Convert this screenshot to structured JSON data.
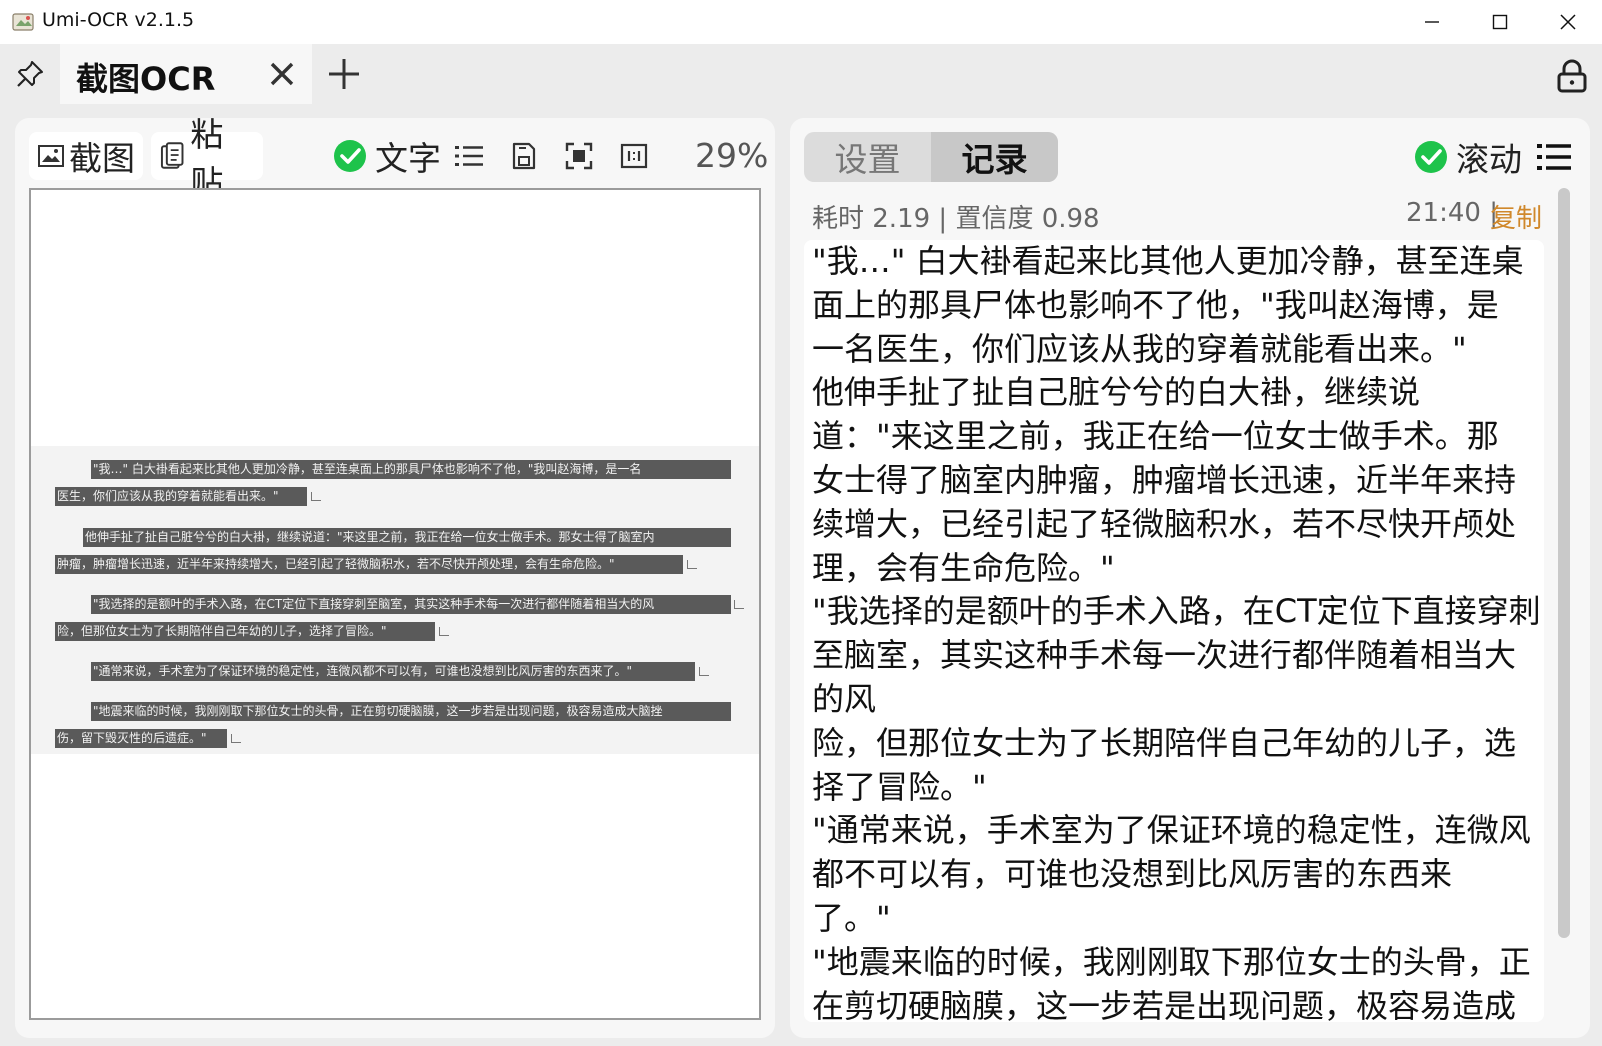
{
  "window": {
    "title": "Umi-OCR v2.1.5",
    "controls": [
      "minimize",
      "maximize",
      "close"
    ]
  },
  "tabs": {
    "active_label": "截图OCR",
    "icons": {
      "pin": "pin-icon",
      "close": "close-icon",
      "add": "plus-icon",
      "lock": "lock-icon"
    }
  },
  "left_toolbar": {
    "screenshot_label": "截图",
    "paste_label": "粘贴",
    "text_toggle_label": "文字",
    "text_toggle_checked": true,
    "zoom": "29%"
  },
  "image_preview": {
    "lines": [
      "\"我…\" 白大褂看起来比其他人更加冷静，甚至连桌面上的那具尸体也影响不了他，\"我叫赵海博，是一名",
      "医生，你们应该从我的穿着就能看出来。\"",
      "他伸手扯了扯自己脏兮兮的白大褂，继续说道：\"来这里之前，我正在给一位女士做手术。那女士得了脑室内",
      "肿瘤，肿瘤增长迅速，近半年来持续增大，已经引起了轻微脑积水，若不尽快开颅处理，会有生命危险。\"",
      "\"我选择的是额叶的手术入路，在CT定位下直接穿刺至脑室，其实这种手术每一次进行都伴随着相当大的风",
      "险，但那位女士为了长期陪伴自己年幼的儿子，选择了冒险。\"",
      "\"通常来说，手术室为了保证环境的稳定性，连微风都不可以有，可谁也没想到比风厉害的东西来了。\"",
      "\"地震来临的时候，我刚刚取下那位女士的头骨，正在剪切硬脑膜，这一步若是出现问题，极容易造成大脑挫",
      "伤，留下毁灭性的后遗症。\""
    ]
  },
  "right_panel": {
    "tab_settings": "设置",
    "tab_records": "记录",
    "scroll_label": "滚动",
    "scroll_checked": true,
    "record": {
      "meta": "耗时 2.19 | 置信度 0.98",
      "time": "21:40 |",
      "copy_label": "复制",
      "lines": [
        "\"我…\" 白大褂看起来比其他人更加冷静，甚至连桌",
        "面上的那具尸体也影响不了他，\"我叫赵海博，是",
        "一名医生，你们应该从我的穿着就能看出来。\"",
        "他伸手扯了扯自己脏兮兮的白大褂，继续说",
        "道：\"来这里之前，我正在给一位女士做手术。那",
        "女士得了脑室内肿瘤，肿瘤增长迅速，近半年来持",
        "续增大，已经引起了轻微脑积水，若不尽快开颅处",
        "理，会有生命危险。\"",
        "\"我选择的是额叶的手术入路，在CT定位下直接穿刺",
        "至脑室，其实这种手术每一次进行都伴随着相当大",
        "的风",
        "险，但那位女士为了长期陪伴自己年幼的儿子，选",
        "择了冒险。\"",
        "\"通常来说，手术室为了保证环境的稳定性，连微风",
        "都不可以有，可谁也没想到比风厉害的东西来",
        "了。\"",
        "\"地震来临的时候，我刚刚取下那位女士的头骨，正",
        "在剪切硬脑膜，这一步若是出现问题，极容易造成"
      ]
    }
  },
  "colors": {
    "check_green": "#1ec34b",
    "copy_link": "#d0882b",
    "panel_bg": "#f7f7f7",
    "window_bg": "#ececec"
  }
}
